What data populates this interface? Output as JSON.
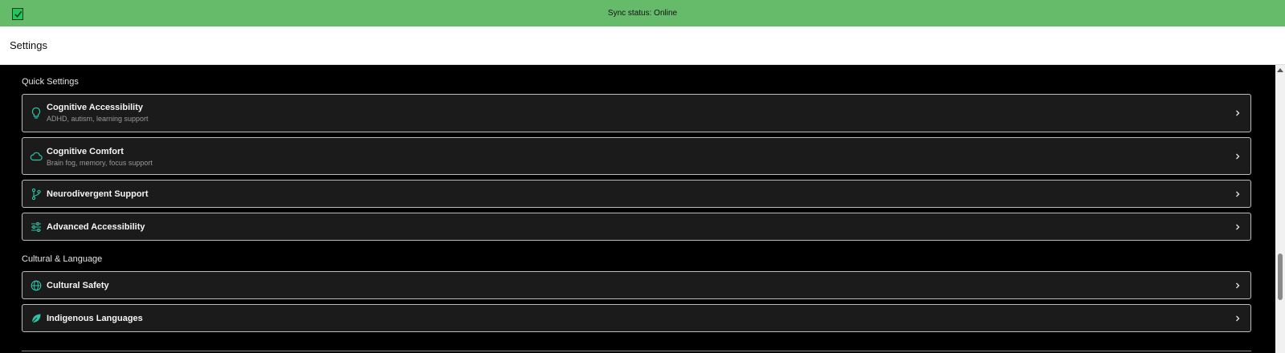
{
  "status": {
    "text": "Sync status: Online",
    "icon": "check-icon"
  },
  "header": {
    "title": "Settings"
  },
  "sections": [
    {
      "title": "Quick Settings",
      "items": [
        {
          "title": "Cognitive Accessibility",
          "subtitle": "ADHD, autism, learning support",
          "icon": "lightbulb-icon"
        },
        {
          "title": "Cognitive Comfort",
          "subtitle": "Brain fog, memory, focus support",
          "icon": "cloud-icon"
        },
        {
          "title": "Neurodivergent Support",
          "subtitle": "",
          "icon": "branch-icon"
        },
        {
          "title": "Advanced Accessibility",
          "subtitle": "",
          "icon": "sliders-icon"
        }
      ]
    },
    {
      "title": "Cultural & Language",
      "items": [
        {
          "title": "Cultural Safety",
          "subtitle": "",
          "icon": "globe-icon"
        },
        {
          "title": "Indigenous Languages",
          "subtitle": "",
          "icon": "leaf-icon"
        }
      ]
    }
  ],
  "colors": {
    "accent": "#2ec4a6",
    "status_bg": "#66bb6a",
    "card_bg": "#1b1b1b"
  }
}
